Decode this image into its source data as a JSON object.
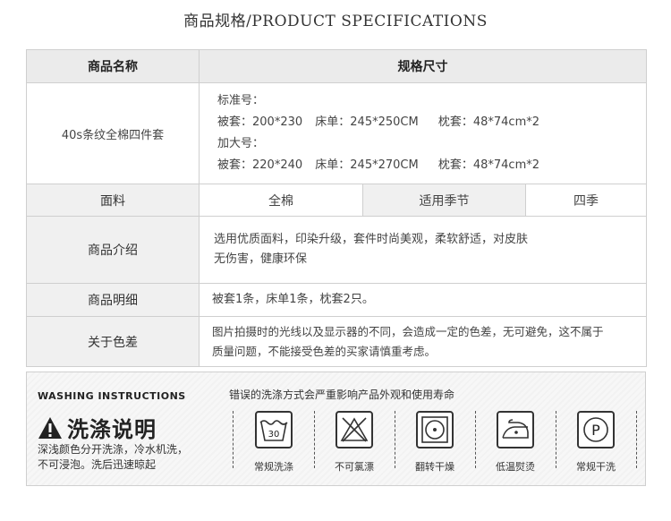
{
  "page_title": "商品规格/PRODUCT SPECIFICATIONS",
  "table": {
    "header_name_label": "商品名称",
    "header_spec_label": "规格尺寸",
    "product_name": "40s条纹全棉四件套",
    "sizes": {
      "standard_label": "标准号：",
      "standard_line": {
        "quilt": "被套：200*230",
        "sheet": "床单：245*250CM",
        "pillow": "枕套：48*74cm*2"
      },
      "large_label": "加大号：",
      "large_line": {
        "quilt": "被套：220*240",
        "sheet": "床单：245*270CM",
        "pillow": "枕套：48*74cm*2"
      }
    },
    "fabric_label": "面料",
    "fabric_value": "全棉",
    "season_label": "适用季节",
    "season_value": "四季",
    "intro_label": "商品介绍",
    "intro_line1": "选用优质面料，印染升级，套件时尚美观，柔软舒适，对皮肤",
    "intro_line2": "无伤害，健康环保",
    "detail_label": "商品明细",
    "detail_value": "被套1条，床单1条，枕套2只。",
    "color_label": "关于色差",
    "color_line1": "图片拍摄时的光线以及显示器的不同，会造成一定的色差，无可避免，这不属于",
    "color_line2": "质量问题，不能接受色差的买家请慎重考虑。"
  },
  "washing": {
    "title_en": "WASHING INSTRUCTIONS",
    "title_cn": "洗涤说明",
    "desc_line1": "深浅颜色分开洗涤，冷水机洗，",
    "desc_line2": "不可浸泡。洗后迅速晾起",
    "warning": "错误的洗涤方式会严重影响产品外观和使用寿命",
    "care_items": [
      {
        "icon": "wash-30-icon",
        "label": "常规洗涤",
        "icon_text": "30"
      },
      {
        "icon": "no-bleach-icon",
        "label": "不可氯漂"
      },
      {
        "icon": "tumble-dry-icon",
        "label": "翻转干燥"
      },
      {
        "icon": "low-iron-icon",
        "label": "低温熨烫"
      },
      {
        "icon": "dry-clean-p-icon",
        "label": "常规干洗",
        "icon_text": "P"
      }
    ]
  }
}
